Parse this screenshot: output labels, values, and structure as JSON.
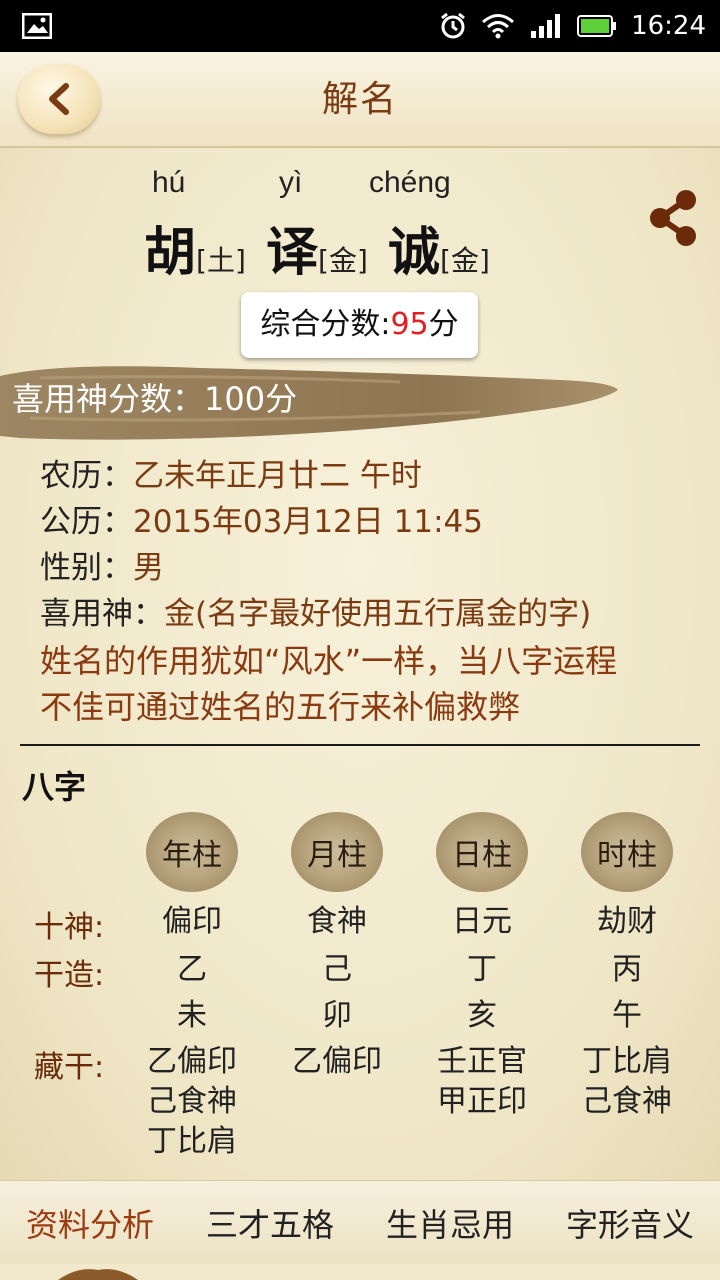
{
  "status": {
    "time": "16:24"
  },
  "header": {
    "title": "解名"
  },
  "name": {
    "chars": [
      {
        "pinyin": "hú",
        "char": "胡",
        "element": "[土]"
      },
      {
        "pinyin": "yì",
        "char": "译",
        "element": "[金]"
      },
      {
        "pinyin": "chéng",
        "char": "诚",
        "element": "[金]"
      }
    ]
  },
  "score": {
    "label": "综合分数:",
    "value": "95",
    "unit": "分"
  },
  "favorable_score": {
    "label": "喜用神分数：",
    "value": "100",
    "unit": "分"
  },
  "info": {
    "lunar_label": "农历：",
    "lunar_value": "乙未年正月廿二 午时",
    "solar_label": "公历：",
    "solar_value": "2015年03月12日 11:45",
    "gender_label": "性别：",
    "gender_value": "男",
    "god_label": "喜用神：",
    "god_value": "金(名字最好使用五行属金的字)"
  },
  "note": {
    "line1": "姓名的作用犹如“风水”一样，当八字运程",
    "line2": "不佳可通过姓名的五行来补偏救弊"
  },
  "bazi": {
    "title": "八字",
    "pillars": [
      "年柱",
      "月柱",
      "日柱",
      "时柱"
    ],
    "labels": {
      "shishen": "十神:",
      "ganzao": "干造:",
      "canggan": "藏干:"
    },
    "shishen": [
      "偏印",
      "食神",
      "日元",
      "劫财"
    ],
    "gan": [
      "乙",
      "己",
      "丁",
      "丙"
    ],
    "zhi": [
      "未",
      "卯",
      "亥",
      "午"
    ],
    "canggan": [
      [
        "乙偏印",
        "己食神",
        "丁比肩"
      ],
      [
        "乙偏印",
        "",
        ""
      ],
      [
        "壬正官",
        "甲正印",
        ""
      ],
      [
        "丁比肩",
        "己食神",
        ""
      ]
    ]
  },
  "tabs": [
    "资料分析",
    "三才五格",
    "生肖忌用",
    "字形音义"
  ]
}
